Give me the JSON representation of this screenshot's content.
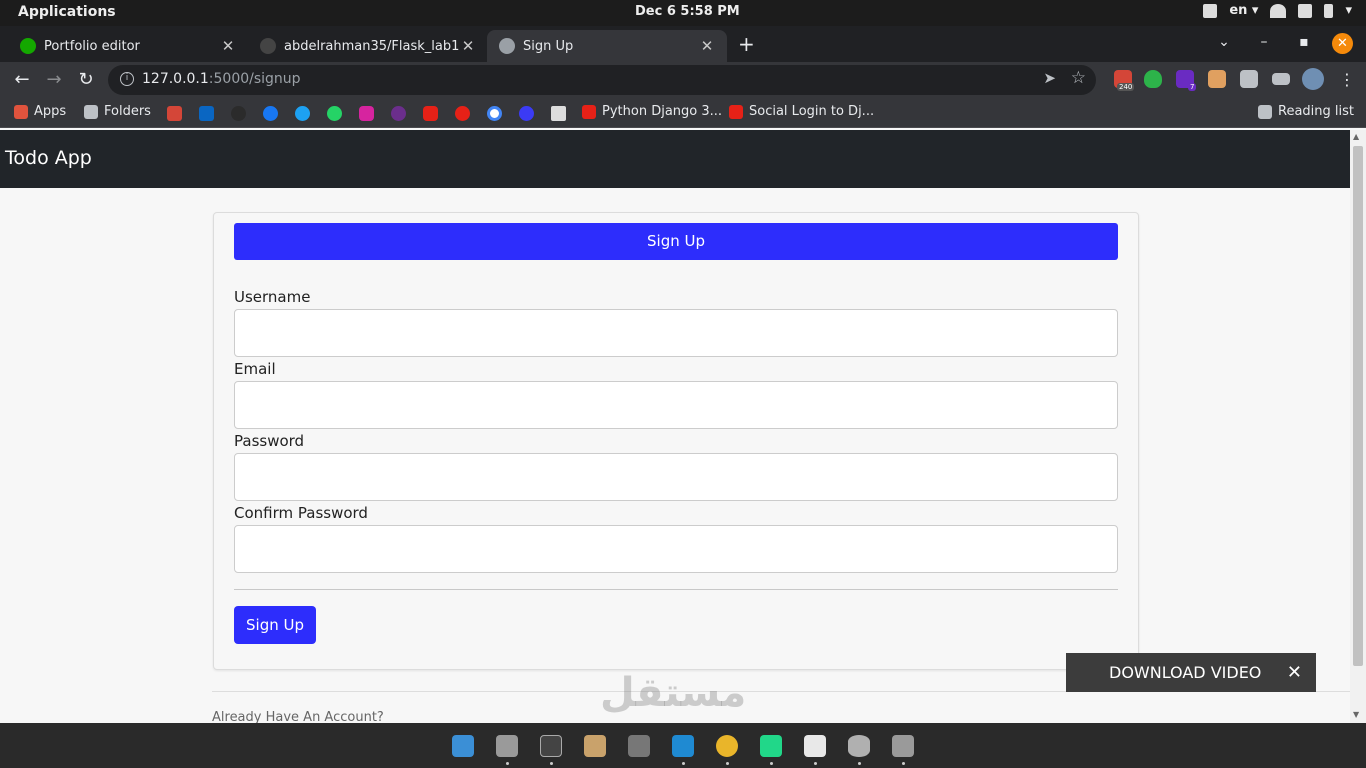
{
  "system": {
    "applications_label": "Applications",
    "clock": "Dec 6   5:58 PM",
    "language": "en"
  },
  "tabs": [
    {
      "title": "Portfolio editor",
      "favicon_color": "#14a800"
    },
    {
      "title": "abdelrahman35/Flask_lab1",
      "favicon_color": "#444444"
    },
    {
      "title": "Sign Up",
      "favicon_color": "#9aa0a6"
    }
  ],
  "omnibox": {
    "host": "127.0.0.1",
    "path": ":5000/signup"
  },
  "extensions": {
    "gmail_badge": "240",
    "ext_badge": "7"
  },
  "bookmarks": {
    "apps_label": "Apps",
    "folders_label": "Folders",
    "python_label": "Python Django 3...",
    "social_label": "Social Login to Dj...",
    "reading_list_label": "Reading list"
  },
  "page": {
    "brand": "Todo App",
    "card_header": "Sign Up",
    "fields": [
      {
        "label": "Username",
        "value": ""
      },
      {
        "label": "Email",
        "value": ""
      },
      {
        "label": "Password",
        "value": ""
      },
      {
        "label": "Confirm Password",
        "value": ""
      }
    ],
    "submit_label": "Sign Up",
    "already_account": "Already Have An Account?"
  },
  "overlay": {
    "download_label": "DOWNLOAD VIDEO",
    "close_glyph": "✕",
    "watermark": "مستقل"
  },
  "colors": {
    "primary_button": "#2d2dfc",
    "navbar": "#212529",
    "chrome_dark": "#202124",
    "chrome_toolbar": "#35363a"
  }
}
